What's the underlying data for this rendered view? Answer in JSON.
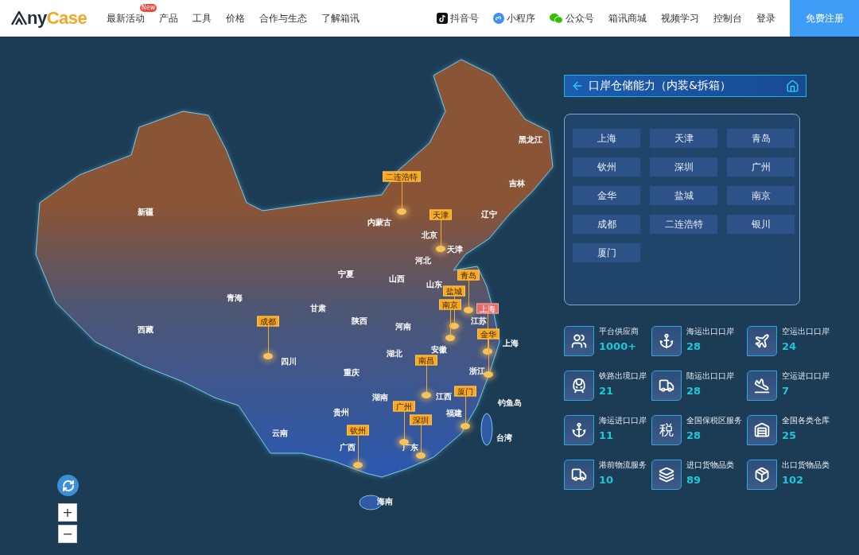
{
  "header": {
    "logo": {
      "text_1": "ny",
      "text_2": "Case"
    },
    "nav": [
      {
        "label": "最新活动",
        "badge": "New"
      },
      {
        "label": "产品"
      },
      {
        "label": "工具"
      },
      {
        "label": "价格"
      },
      {
        "label": "合作与生态"
      },
      {
        "label": "了解箱讯"
      }
    ],
    "links": [
      {
        "label": "抖音号",
        "kind": "douyin"
      },
      {
        "label": "小程序",
        "kind": "mini"
      },
      {
        "label": "公众号",
        "kind": "wechat"
      },
      {
        "label": "箱讯商城"
      },
      {
        "label": "视频学习"
      },
      {
        "label": "控制台"
      },
      {
        "label": "登录"
      }
    ],
    "register": "免费注册"
  },
  "map": {
    "provinces": [
      "黑龙江",
      "吉林",
      "辽宁",
      "内蒙古",
      "新疆",
      "北京",
      "天津",
      "河北",
      "宁夏",
      "山西",
      "山东",
      "青海",
      "甘肃",
      "江苏",
      "陕西",
      "河南",
      "西藏",
      "上海",
      "安徽",
      "湖北",
      "四川",
      "浙江",
      "重庆",
      "江西",
      "湖南",
      "钓鱼岛",
      "福建",
      "贵州",
      "云南",
      "台湾",
      "广西",
      "广东",
      "海南"
    ],
    "pins": [
      {
        "label": "二连浩特",
        "selected": false
      },
      {
        "label": "天津",
        "selected": false
      },
      {
        "label": "青岛",
        "selected": false
      },
      {
        "label": "盐城",
        "selected": false
      },
      {
        "label": "南京",
        "selected": false
      },
      {
        "label": "上海",
        "selected": true
      },
      {
        "label": "金华",
        "selected": false
      },
      {
        "label": "成都",
        "selected": false
      },
      {
        "label": "南昌",
        "selected": false
      },
      {
        "label": "厦门",
        "selected": false
      },
      {
        "label": "广州",
        "selected": false
      },
      {
        "label": "深圳",
        "selected": false
      },
      {
        "label": "钦州",
        "selected": false
      }
    ],
    "zoom_in": "+",
    "zoom_out": "−"
  },
  "panel": {
    "title": "口岸仓储能力（内装&拆箱）",
    "cities": [
      "上海",
      "天津",
      "青岛",
      "钦州",
      "深圳",
      "广州",
      "金华",
      "盐城",
      "南京",
      "成都",
      "二连浩特",
      "银川",
      "厦门"
    ],
    "stats": [
      {
        "label": "平台供应商",
        "value": "1000+"
      },
      {
        "label": "海运出口口岸",
        "value": "28"
      },
      {
        "label": "空运出口口岸",
        "value": "24"
      },
      {
        "label": "铁路出境口岸",
        "value": "21"
      },
      {
        "label": "陆运出口口岸",
        "value": "28"
      },
      {
        "label": "空运进口口岸",
        "value": "7"
      },
      {
        "label": "海运进口口岸",
        "value": "11"
      },
      {
        "label": "全国保税区服务",
        "value": "28",
        "glyph": "税"
      },
      {
        "label": "全国各类仓库",
        "value": "25"
      },
      {
        "label": "港前物流服务",
        "value": "10"
      },
      {
        "label": "进口货物品类",
        "value": "89"
      },
      {
        "label": "出口货物品类",
        "value": "102"
      }
    ]
  }
}
